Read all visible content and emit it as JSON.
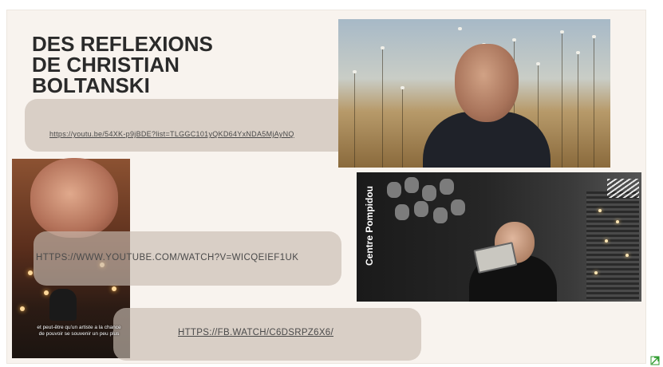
{
  "slide": {
    "title_lines": [
      "DES REFLEXIONS",
      "DE CHRISTIAN",
      "BOLTANSKI"
    ],
    "links": [
      "https://youtu.be/54XK-p9jBDE?list=TLGGC101yQKD64YxNDA5MjAyNQ",
      "HTTPS://WWW.YOUTUBE.COM/WATCH?V=WICQEIEF1UK",
      "HTTPS://FB.WATCH/C6DSRPZ6X6/"
    ],
    "video_subtitle_lines": [
      "et peut-être qu'un artiste a la chance",
      "de pouvoir se souvenir un peu plus"
    ],
    "video_vertical_label": "Centre Pompidou"
  },
  "icons": {
    "expand": "expand-icon"
  },
  "colors": {
    "slide_background": "#f8f3ee",
    "pill": "#c8bcb0",
    "accent": "#2e9b2e"
  }
}
